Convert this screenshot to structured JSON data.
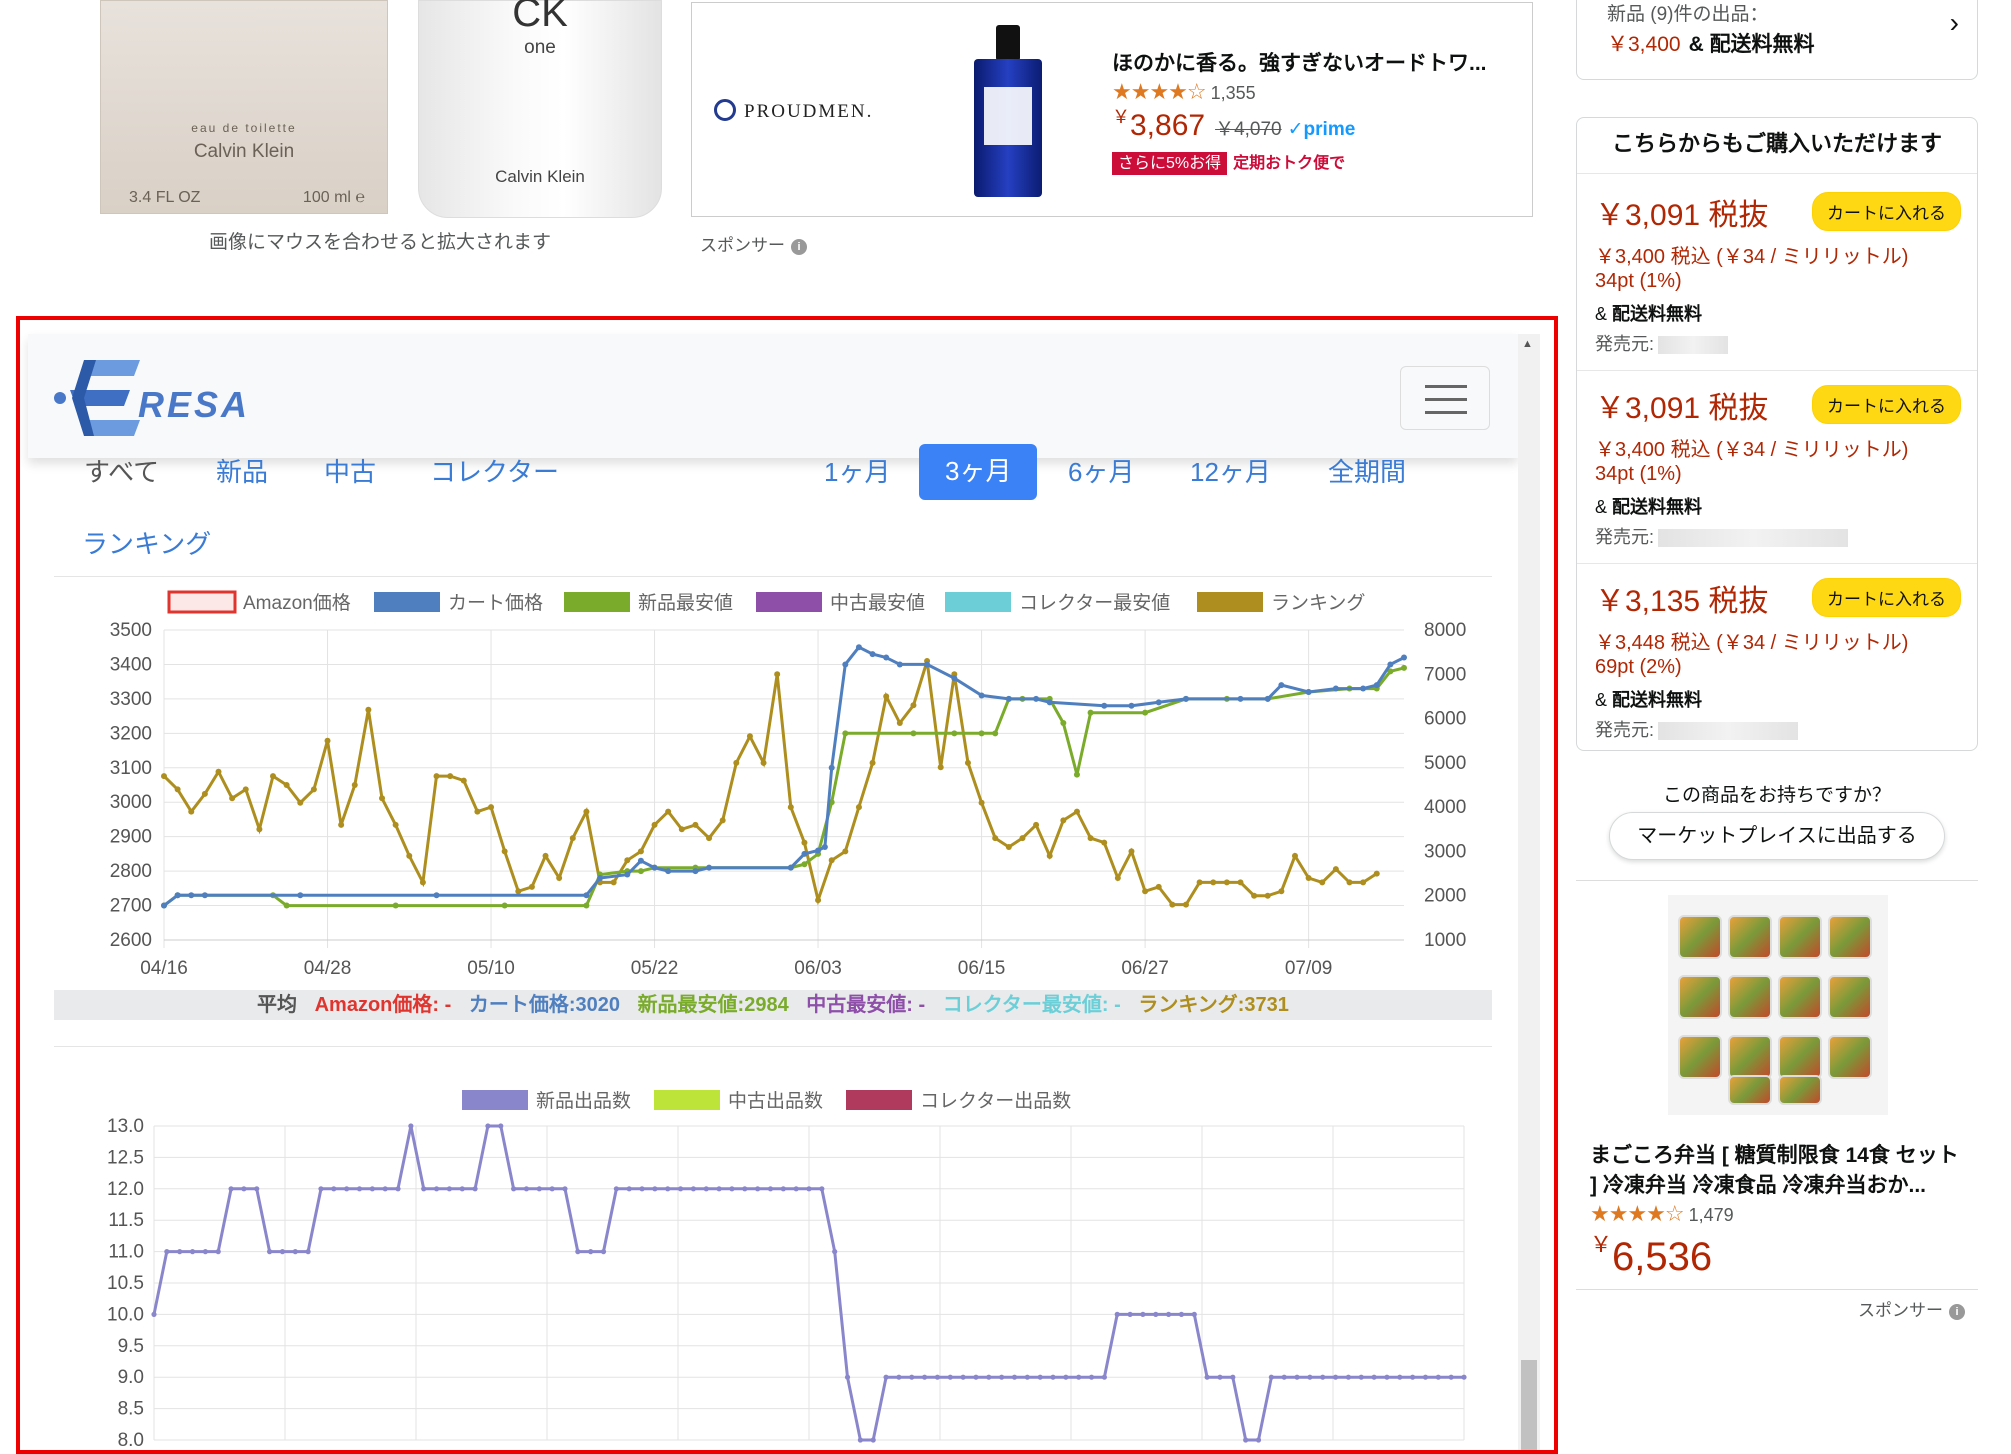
{
  "product_images": {
    "box_brand": "Calvin Klein",
    "box_type": "eau de toilette",
    "box_size_oz": "3.4 FL OZ",
    "box_size_ml": "100 ml ℮",
    "bottle_logo": "CK",
    "bottle_name": "one",
    "bottle_brand": "Calvin Klein",
    "zoom_hint": "画像にマウスを合わせると拡大されます"
  },
  "ad": {
    "brand": "PROUDMEN.",
    "title": "ほのかに香る。強すぎないオードトワ...",
    "rating_count": "1,355",
    "price_symbol": "￥",
    "price": "3,867",
    "list_price": "￥4,070",
    "prime": "prime",
    "promo_badge": "さらに5%お得",
    "promo_text": "定期おトク便で",
    "sponsor": "スポンサー"
  },
  "new_offers": {
    "line1": "新品 (9)件の出品：",
    "price": "￥3,400",
    "shipping": "& 配送料無料"
  },
  "offers": {
    "header": "こちらからもご購入いただけます",
    "items": [
      {
        "price": "￥3,091 税抜",
        "cart": "カートに入れる",
        "incl": "￥3,400 税込 (￥34 / ミリリットル)",
        "points": "34pt (1%)",
        "ship_amp": "&",
        "ship": "配送料無料",
        "seller": "発売元:"
      },
      {
        "price": "￥3,091 税抜",
        "cart": "カートに入れる",
        "incl": "￥3,400 税込 (￥34 / ミリリットル)",
        "points": "34pt (1%)",
        "ship_amp": "&",
        "ship": "配送料無料",
        "seller": "発売元:"
      },
      {
        "price": "￥3,135 税抜",
        "cart": "カートに入れる",
        "incl": "￥3,448 税込 (￥34 / ミリリットル)",
        "points": "69pt (2%)",
        "ship_amp": "&",
        "ship": "配送料無料",
        "seller": "発売元:"
      }
    ]
  },
  "own_question": "この商品をお持ちですか？",
  "marketplace_button": "マーケットプレイスに出品する",
  "side_ad": {
    "title": "まごころ弁当 [ 糖質制限食 14食 セット ] 冷凍弁当 冷凍食品 冷凍弁当おか...",
    "rating_count": "1,479",
    "price_symbol": "￥",
    "price": "6,536",
    "sponsor": "スポンサー"
  },
  "eresa": {
    "logo": "RESA",
    "tabs": [
      "すべて",
      "新品",
      "中古",
      "コレクター"
    ],
    "ranking_tab": "ランキング",
    "ranges": [
      "1ヶ月",
      "3ヶ月",
      "6ヶ月",
      "12ヶ月",
      "全期間"
    ],
    "active_range": "3ヶ月",
    "avg": {
      "label": "平均",
      "amazon": "Amazon価格: -",
      "cart": "カート価格:3020",
      "new": "新品最安値:2984",
      "used": "中古最安値: -",
      "collector": "コレクター最安値: -",
      "ranking": "ランキング:3731"
    }
  },
  "colors": {
    "amazon": "#e0342f",
    "cart": "#4f7fbf",
    "new": "#7aab2b",
    "used": "#8e4fa8",
    "collector": "#6ccfd8",
    "ranking": "#ad8e1e",
    "new_count": "#8a86cc",
    "used_count": "#bde438",
    "collector_count": "#b03a5e"
  },
  "chart_data": [
    {
      "type": "line",
      "legend": [
        "Amazon価格",
        "カート価格",
        "新品最安値",
        "中古最安値",
        "コレクター最安値",
        "ランキング"
      ],
      "x_ticks": [
        "04/16",
        "04/28",
        "05/10",
        "05/22",
        "06/03",
        "06/15",
        "06/27",
        "07/09"
      ],
      "y_left": {
        "min": 2600,
        "max": 3500,
        "ticks": [
          3500,
          3400,
          3300,
          3200,
          3100,
          3000,
          2900,
          2800,
          2700,
          2600
        ]
      },
      "y_right": {
        "min": 1000,
        "max": 8000,
        "ticks": [
          8000,
          7000,
          6000,
          5000,
          4000,
          3000,
          2000,
          1000
        ]
      },
      "series": [
        {
          "name": "カート価格",
          "axis": "left",
          "points": [
            [
              0,
              2700
            ],
            [
              1,
              2730
            ],
            [
              2,
              2730
            ],
            [
              3,
              2730
            ],
            [
              10,
              2730
            ],
            [
              20,
              2730
            ],
            [
              31,
              2730
            ],
            [
              32,
              2780
            ],
            [
              34,
              2790
            ],
            [
              35,
              2830
            ],
            [
              36,
              2810
            ],
            [
              37,
              2800
            ],
            [
              39,
              2800
            ],
            [
              40,
              2810
            ],
            [
              46,
              2810
            ],
            [
              47,
              2850
            ],
            [
              48,
              2860
            ],
            [
              48.5,
              2870
            ],
            [
              49,
              3100
            ],
            [
              50,
              3400
            ],
            [
              51,
              3450
            ],
            [
              52,
              3430
            ],
            [
              53,
              3420
            ],
            [
              54,
              3400
            ],
            [
              56,
              3400
            ],
            [
              58,
              3360
            ],
            [
              60,
              3310
            ],
            [
              62,
              3300
            ],
            [
              64,
              3300
            ],
            [
              65,
              3290
            ],
            [
              69,
              3280
            ],
            [
              71,
              3280
            ],
            [
              73,
              3290
            ],
            [
              75,
              3300
            ],
            [
              79,
              3300
            ],
            [
              81,
              3300
            ],
            [
              82,
              3340
            ],
            [
              84,
              3320
            ],
            [
              86,
              3330
            ],
            [
              88,
              3330
            ],
            [
              89,
              3340
            ],
            [
              90,
              3400
            ],
            [
              91,
              3420
            ]
          ]
        },
        {
          "name": "新品最安値",
          "axis": "left",
          "points": [
            [
              0,
              2700
            ],
            [
              1,
              2730
            ],
            [
              8,
              2730
            ],
            [
              9,
              2700
            ],
            [
              17,
              2700
            ],
            [
              25,
              2700
            ],
            [
              31,
              2700
            ],
            [
              32,
              2790
            ],
            [
              34,
              2800
            ],
            [
              35,
              2800
            ],
            [
              36,
              2810
            ],
            [
              39,
              2810
            ],
            [
              46,
              2810
            ],
            [
              47,
              2820
            ],
            [
              48,
              2850
            ],
            [
              49,
              3000
            ],
            [
              50,
              3200
            ],
            [
              55,
              3200
            ],
            [
              58,
              3200
            ],
            [
              60,
              3200
            ],
            [
              61,
              3200
            ],
            [
              62,
              3300
            ],
            [
              63,
              3300
            ],
            [
              65,
              3300
            ],
            [
              66,
              3230
            ],
            [
              67,
              3080
            ],
            [
              68,
              3260
            ],
            [
              72,
              3260
            ],
            [
              75,
              3300
            ],
            [
              78,
              3300
            ],
            [
              81,
              3300
            ],
            [
              84,
              3320
            ],
            [
              87,
              3330
            ],
            [
              89,
              3330
            ],
            [
              90,
              3380
            ],
            [
              91,
              3390
            ]
          ]
        },
        {
          "name": "ランキング",
          "axis": "right",
          "points": [
            [
              0,
              4700
            ],
            [
              1,
              4400
            ],
            [
              2,
              3900
            ],
            [
              3,
              4300
            ],
            [
              4,
              4800
            ],
            [
              5,
              4200
            ],
            [
              6,
              4400
            ],
            [
              7,
              3500
            ],
            [
              8,
              4700
            ],
            [
              9,
              4500
            ],
            [
              10,
              4100
            ],
            [
              11,
              4400
            ],
            [
              12,
              5500
            ],
            [
              13,
              3600
            ],
            [
              14,
              4500
            ],
            [
              15,
              6200
            ],
            [
              16,
              4200
            ],
            [
              17,
              3600
            ],
            [
              18,
              2900
            ],
            [
              19,
              2300
            ],
            [
              20,
              4700
            ],
            [
              21,
              4700
            ],
            [
              22,
              4600
            ],
            [
              23,
              3900
            ],
            [
              24,
              4000
            ],
            [
              25,
              3000
            ],
            [
              26,
              2100
            ],
            [
              27,
              2200
            ],
            [
              28,
              2900
            ],
            [
              29,
              2400
            ],
            [
              30,
              3300
            ],
            [
              31,
              3900
            ],
            [
              32,
              2300
            ],
            [
              33,
              2300
            ],
            [
              34,
              2800
            ],
            [
              35,
              3000
            ],
            [
              36,
              3600
            ],
            [
              37,
              3900
            ],
            [
              38,
              3500
            ],
            [
              39,
              3600
            ],
            [
              40,
              3300
            ],
            [
              41,
              3700
            ],
            [
              42,
              5000
            ],
            [
              43,
              5600
            ],
            [
              44,
              5000
            ],
            [
              45,
              7000
            ],
            [
              46,
              4000
            ],
            [
              47,
              3200
            ],
            [
              48,
              1900
            ],
            [
              49,
              2800
            ],
            [
              50,
              3000
            ],
            [
              51,
              4000
            ],
            [
              52,
              5000
            ],
            [
              53,
              6500
            ],
            [
              54,
              5900
            ],
            [
              55,
              6300
            ],
            [
              56,
              7300
            ],
            [
              57,
              4900
            ],
            [
              58,
              7000
            ],
            [
              59,
              5000
            ],
            [
              60,
              4100
            ],
            [
              61,
              3300
            ],
            [
              62,
              3100
            ],
            [
              63,
              3300
            ],
            [
              64,
              3600
            ],
            [
              65,
              2900
            ],
            [
              66,
              3700
            ],
            [
              67,
              3900
            ],
            [
              68,
              3300
            ],
            [
              69,
              3200
            ],
            [
              70,
              2400
            ],
            [
              71,
              3000
            ],
            [
              72,
              2100
            ],
            [
              73,
              2200
            ],
            [
              74,
              1800
            ],
            [
              75,
              1800
            ],
            [
              76,
              2300
            ],
            [
              77,
              2300
            ],
            [
              78,
              2300
            ],
            [
              79,
              2300
            ],
            [
              80,
              2000
            ],
            [
              81,
              2000
            ],
            [
              82,
              2100
            ],
            [
              83,
              2900
            ],
            [
              84,
              2400
            ],
            [
              85,
              2300
            ],
            [
              86,
              2600
            ],
            [
              87,
              2300
            ],
            [
              88,
              2300
            ],
            [
              89,
              2500
            ]
          ]
        }
      ]
    },
    {
      "type": "line",
      "legend": [
        "新品出品数",
        "中古出品数",
        "コレクター出品数"
      ],
      "y": {
        "min": 8.0,
        "max": 13.0,
        "ticks": [
          "13.0",
          "12.5",
          "12.0",
          "11.5",
          "11.0",
          "10.5",
          "10.0",
          "9.5",
          "9.0",
          "8.5",
          "8.0"
        ]
      },
      "series": [
        {
          "name": "新品出品数",
          "values": [
            10,
            11,
            11,
            11,
            11,
            11,
            12,
            12,
            12,
            11,
            11,
            11,
            11,
            12,
            12,
            12,
            12,
            12,
            12,
            12,
            13,
            12,
            12,
            12,
            12,
            12,
            13,
            13,
            12,
            12,
            12,
            12,
            12,
            11,
            11,
            11,
            12,
            12,
            12,
            12,
            12,
            12,
            12,
            12,
            12,
            12,
            12,
            12,
            12,
            12,
            12,
            12,
            12,
            11,
            9,
            8,
            8,
            9,
            9,
            9,
            9,
            9,
            9,
            9,
            9,
            9,
            9,
            9,
            9,
            9,
            9,
            9,
            9,
            9,
            9,
            10,
            10,
            10,
            10,
            10,
            10,
            10,
            9,
            9,
            9,
            8,
            8,
            9,
            9,
            9,
            9,
            9,
            9,
            9,
            9,
            9,
            9,
            9,
            9,
            9,
            9,
            9,
            9
          ]
        }
      ]
    }
  ]
}
